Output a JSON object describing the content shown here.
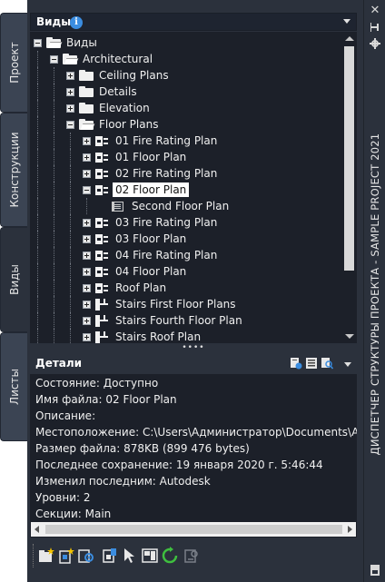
{
  "side_tabs": [
    {
      "label": "Проект",
      "active": false
    },
    {
      "label": "Конструкции",
      "active": false
    },
    {
      "label": "Виды",
      "active": true
    },
    {
      "label": "Листы",
      "active": false
    }
  ],
  "palette_title": "ДИСПЕТЧЕР СТРУКТУРЫ ПРОЕКТА - SAMPLE PROJECT 2021",
  "right_strip": {
    "close_icon": "✕",
    "pin_icon": "auto-hide-icon",
    "props_icon": "properties-icon"
  },
  "views": {
    "title": "Виды",
    "info_icon": "i",
    "tree": [
      {
        "label": "Виды",
        "level": 0,
        "toggle": "minus",
        "icon": "folder-open"
      },
      {
        "label": "Architectural",
        "level": 1,
        "toggle": "minus",
        "icon": "folder-open"
      },
      {
        "label": "Ceiling Plans",
        "level": 2,
        "toggle": "plus",
        "icon": "folder"
      },
      {
        "label": "Details",
        "level": 2,
        "toggle": "plus",
        "icon": "folder"
      },
      {
        "label": "Elevation",
        "level": 2,
        "toggle": "plus",
        "icon": "folder"
      },
      {
        "label": "Floor Plans",
        "level": 2,
        "toggle": "minus",
        "icon": "folder-open"
      },
      {
        "label": "01 Fire Rating Plan",
        "level": 3,
        "toggle": "plus",
        "icon": "view"
      },
      {
        "label": "01 Floor Plan",
        "level": 3,
        "toggle": "plus",
        "icon": "view"
      },
      {
        "label": "02 Fire Rating Plan",
        "level": 3,
        "toggle": "plus",
        "icon": "view"
      },
      {
        "label": "02 Floor Plan",
        "level": 3,
        "toggle": "minus",
        "icon": "view",
        "selected": true
      },
      {
        "label": "Second Floor Plan",
        "level": 4,
        "toggle": "",
        "icon": "sheet"
      },
      {
        "label": "03 Fire Rating Plan",
        "level": 3,
        "toggle": "plus",
        "icon": "view"
      },
      {
        "label": "03 Floor Plan",
        "level": 3,
        "toggle": "plus",
        "icon": "view"
      },
      {
        "label": "04 Fire Rating Plan",
        "level": 3,
        "toggle": "plus",
        "icon": "view"
      },
      {
        "label": "04 Floor Plan",
        "level": 3,
        "toggle": "plus",
        "icon": "view"
      },
      {
        "label": "Roof Plan",
        "level": 3,
        "toggle": "plus",
        "icon": "view"
      },
      {
        "label": "Stairs First Floor Plans",
        "level": 3,
        "toggle": "plus",
        "icon": "stair"
      },
      {
        "label": "Stairs Fourth Floor Plan",
        "level": 3,
        "toggle": "plus",
        "icon": "stair"
      },
      {
        "label": "Stairs Roof Plan",
        "level": 3,
        "toggle": "plus",
        "icon": "stair"
      }
    ]
  },
  "splitter_grip": "••••",
  "details": {
    "title": "Детали",
    "lines": [
      "Состояние: Доступно",
      "Имя файла: 02 Floor Plan",
      "Описание:",
      "Местоположение: C:\\Users\\Администратор\\Documents\\Autodesk",
      "Размер файла: 878KB (899 476 bytes)",
      "Последнее сохранение: 19 января 2020 г.  5:46:44",
      "Изменил последним: Autodesk",
      "Уровни: 2",
      "Секции: Main"
    ]
  },
  "toolbar": {
    "buttons": [
      {
        "name": "new-folder-button"
      },
      {
        "name": "new-view-button"
      },
      {
        "name": "new-view-from-template-button"
      },
      {
        "name": "open-view-button"
      },
      {
        "name": "select-button"
      },
      {
        "name": "sheet-button"
      },
      {
        "name": "refresh-button"
      },
      {
        "name": "repath-button"
      }
    ]
  }
}
